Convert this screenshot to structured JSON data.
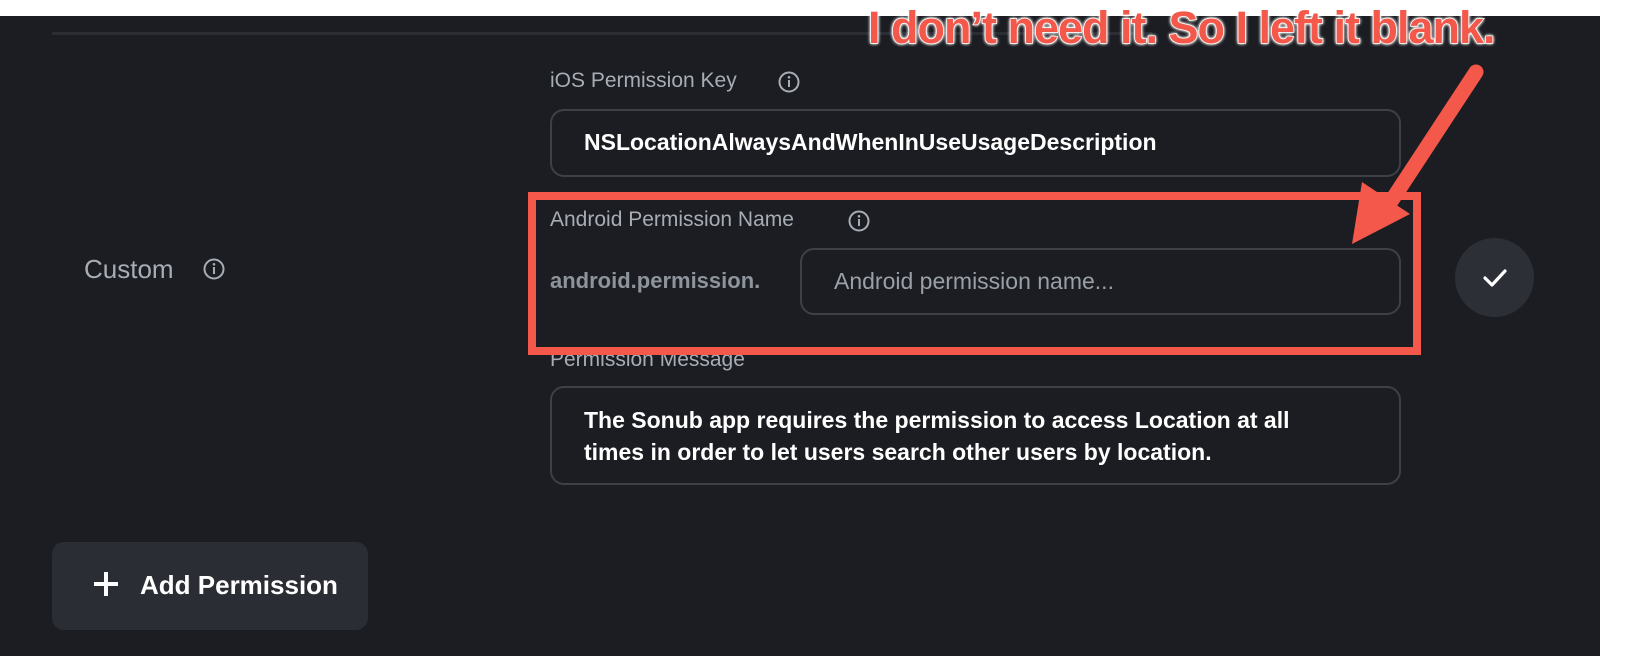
{
  "custom_row": {
    "label": "Custom"
  },
  "ios_field": {
    "label": "iOS Permission Key",
    "value": "NSLocationAlwaysAndWhenInUseUsageDescription"
  },
  "android_field": {
    "label": "Android Permission Name",
    "prefix": "android.permission.",
    "value": "",
    "placeholder": "Android permission name..."
  },
  "message_field": {
    "label": "Permission Message",
    "value": "The Sonub app requires the permission to access Location at all times in order to let users search other users by location."
  },
  "add_button": {
    "label": "Add Permission"
  },
  "annotation": {
    "text": "I don’t need it. So I left it blank.",
    "color": "#f4584a"
  },
  "colors": {
    "background": "#1c1d22",
    "accent_annotation": "#f4584a",
    "input_border": "#3d4046",
    "button_bg": "#2a2d33"
  }
}
